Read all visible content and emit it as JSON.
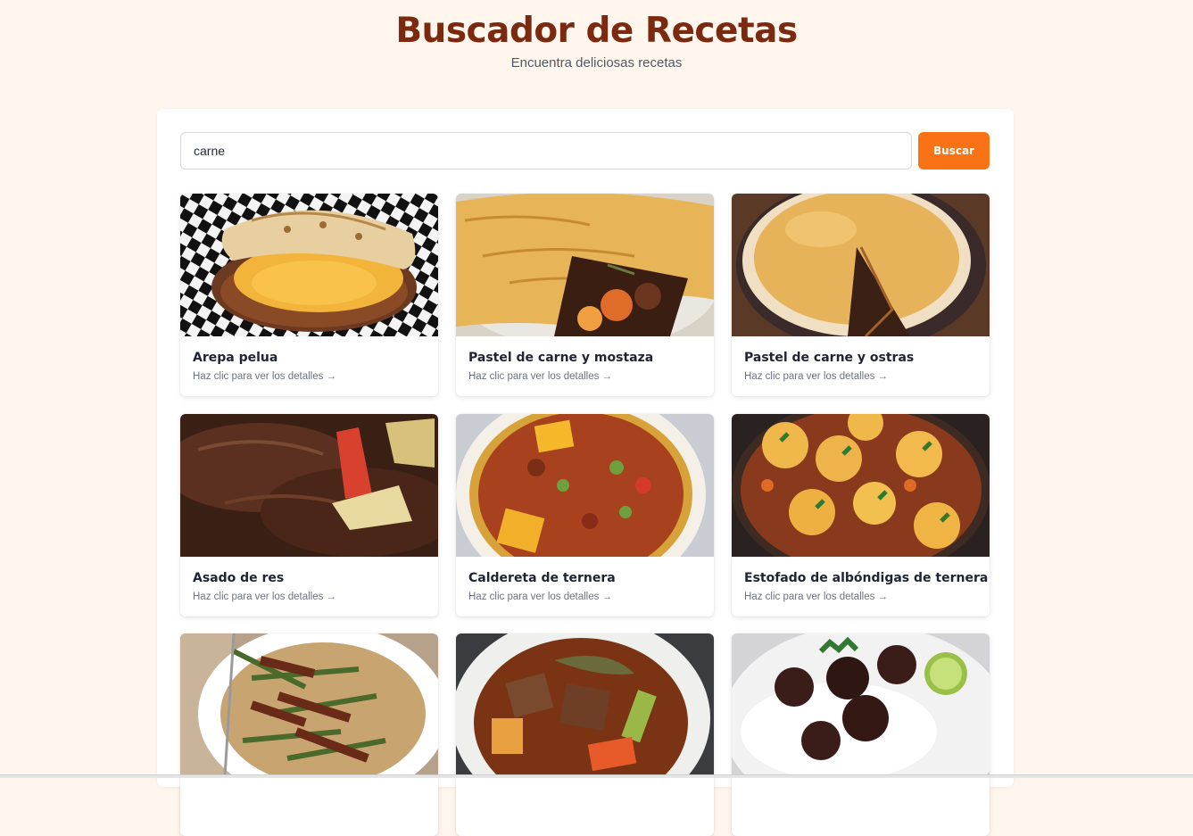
{
  "header": {
    "title": "Buscador de Recetas",
    "subtitle": "Encuentra deliciosas recetas"
  },
  "search": {
    "value": "carne",
    "button_label": "Buscar"
  },
  "card_hint": "Haz clic para ver los detalles →",
  "recipes": [
    {
      "name": "Arepa pelua",
      "hint": "Haz clic para ver los detalles →"
    },
    {
      "name": "Pastel de carne y mostaza",
      "hint": "Haz clic para ver los detalles →"
    },
    {
      "name": "Pastel de carne y ostras",
      "hint": "Haz clic para ver los detalles →"
    },
    {
      "name": "Asado de res",
      "hint": "Haz clic para ver los detalles →"
    },
    {
      "name": "Caldereta de ternera",
      "hint": "Haz clic para ver los detalles →"
    },
    {
      "name": "Estofado de albóndigas de ternera",
      "hint": "Haz clic para ver los detalles →"
    },
    {
      "name": "",
      "hint": ""
    },
    {
      "name": "",
      "hint": ""
    },
    {
      "name": "",
      "hint": ""
    }
  ],
  "colors": {
    "page_bg": "#fff6ee",
    "title": "#7b2a10",
    "accent": "#f97316"
  }
}
